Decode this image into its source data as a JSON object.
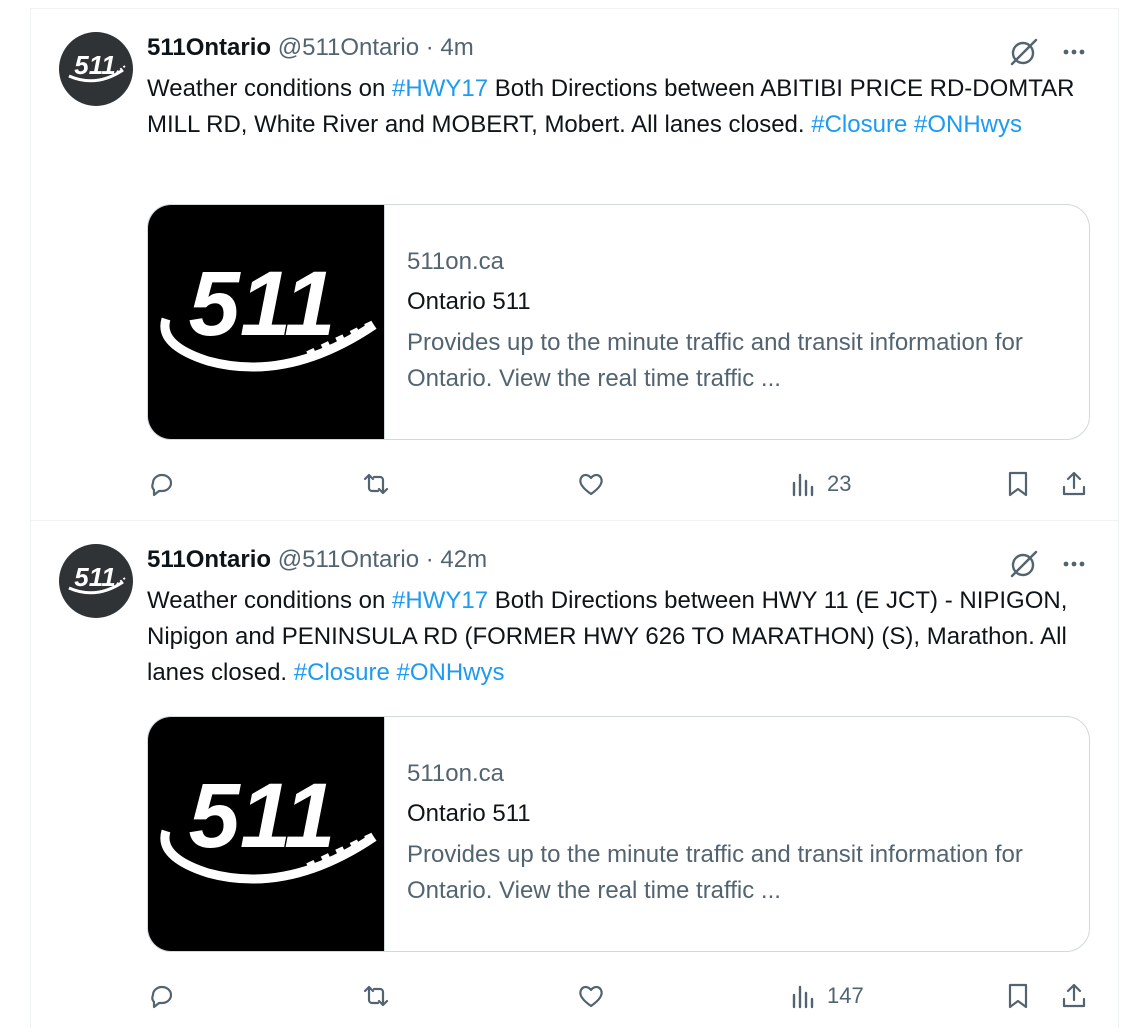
{
  "tweets": [
    {
      "display_name": "511Ontario",
      "handle": "@511Ontario",
      "dot": "·",
      "time": "4m",
      "avatar_text": "511",
      "text": {
        "p1": "Weather conditions on ",
        "tag1": "#HWY17",
        "p2": " Both Directions  between ABITIBI PRICE RD-DOMTAR MILL RD, White River and MOBERT, Mobert. All lanes closed. ",
        "tag2": "#Closure",
        "p3": " ",
        "tag3": "#ONHwys"
      },
      "card": {
        "image_text": "511",
        "domain": "511on.ca",
        "title": "Ontario 511",
        "description": "Provides up to the minute traffic and transit information for Ontario. View the real time traffic ..."
      },
      "views": "23",
      "icons": [
        "grok-icon",
        "more-icon",
        "reply-icon",
        "repost-icon",
        "like-icon",
        "views-icon",
        "bookmark-icon",
        "share-icon"
      ]
    },
    {
      "display_name": "511Ontario",
      "handle": "@511Ontario",
      "dot": "·",
      "time": "42m",
      "avatar_text": "511",
      "text": {
        "p1": "Weather conditions on ",
        "tag1": "#HWY17",
        "p2": " Both Directions  between HWY 11 (E JCT) - NIPIGON, Nipigon and PENINSULA RD (FORMER HWY 626 TO MARATHON) (S), Marathon. All lanes closed. ",
        "tag2": "#Closure",
        "p3": " ",
        "tag3": "#ONHwys"
      },
      "card": {
        "image_text": "511",
        "domain": "511on.ca",
        "title": "Ontario 511",
        "description": "Provides up to the minute traffic and transit information for Ontario. View the real time traffic ..."
      },
      "views": "147",
      "icons": [
        "grok-icon",
        "more-icon",
        "reply-icon",
        "repost-icon",
        "like-icon",
        "views-icon",
        "bookmark-icon",
        "share-icon"
      ]
    }
  ],
  "colors": {
    "link": "#1d9bf0",
    "secondary_text": "#536471",
    "primary_text": "#0f1419",
    "border": "#cfd9de"
  }
}
